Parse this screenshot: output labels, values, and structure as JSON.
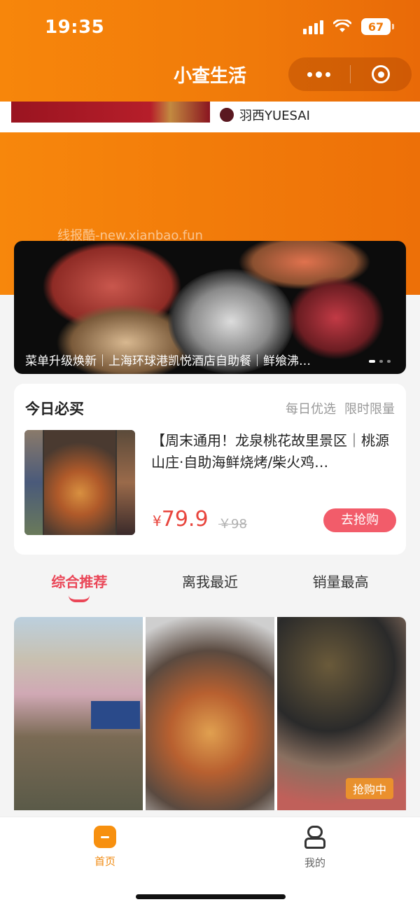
{
  "status_bar": {
    "time": "19:35",
    "battery": "67"
  },
  "header": {
    "title": "小查生活"
  },
  "peek": {
    "shop_name": "羽西YUESAI"
  },
  "watermark": "线报酷-new.xianbao.fun",
  "banner": {
    "caption": "菜单升级焕新｜上海环球港凯悦酒店自助餐｜鲜飨沸…"
  },
  "today": {
    "title": "今日必买",
    "tag1": "每日优选",
    "tag2": "限时限量",
    "description": "【周末通用！龙泉桃花故里景区｜桃源山庄·自助海鲜烧烤/柴火鸡…",
    "currency": "¥",
    "price": "79.9",
    "old_price": "￥98",
    "buy_label": "去抢购"
  },
  "tabs": [
    {
      "label": "综合推荐"
    },
    {
      "label": "离我最近"
    },
    {
      "label": "销量最高"
    }
  ],
  "grid": {
    "badge": "抢购中"
  },
  "tabbar": {
    "home_label": "首页",
    "me_label": "我的"
  },
  "colors": {
    "brand_orange": "#f07a0a",
    "accent_red": "#ea4657",
    "price_red": "#e8453d"
  }
}
